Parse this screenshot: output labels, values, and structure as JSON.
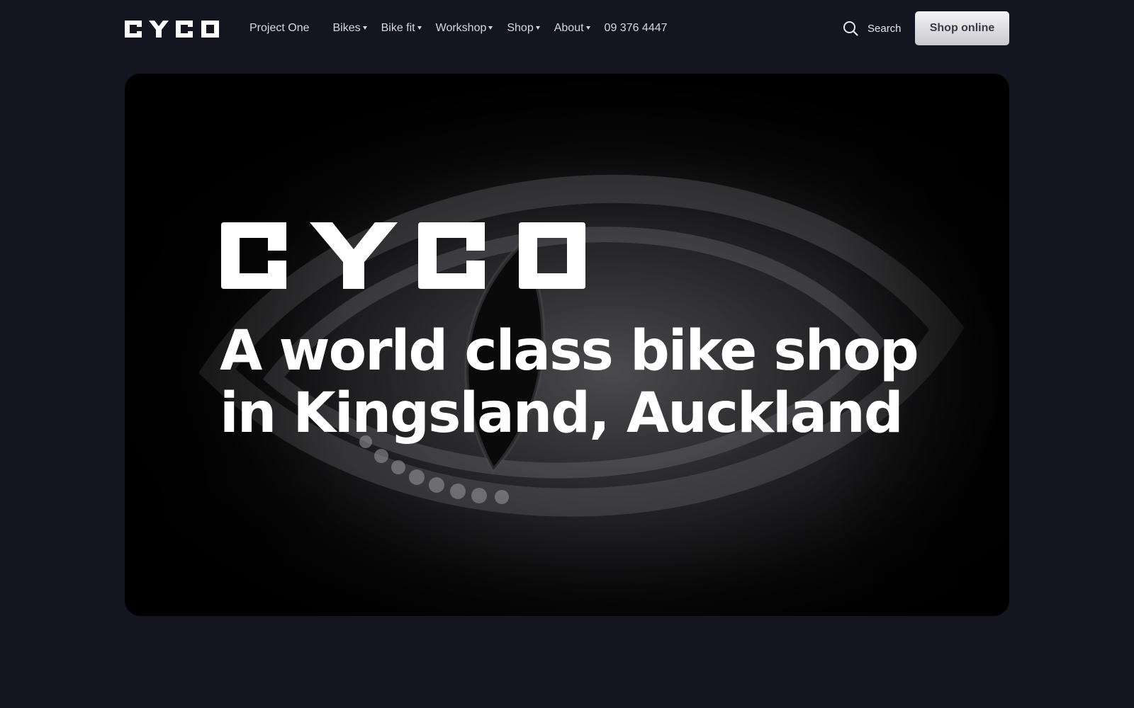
{
  "header": {
    "logo_alt": "CYCO",
    "nav": [
      {
        "label": "Project One",
        "dropdown": false
      },
      {
        "label": "Bikes",
        "dropdown": true
      },
      {
        "label": "Bike fit",
        "dropdown": true
      },
      {
        "label": "Workshop",
        "dropdown": true
      },
      {
        "label": "Shop",
        "dropdown": true
      },
      {
        "label": "About",
        "dropdown": true
      },
      {
        "label": "09 376 4447",
        "dropdown": false
      }
    ],
    "search_label": "Search",
    "search_icon": "search-icon",
    "cta_label": "Shop online"
  },
  "hero": {
    "logo_text": "CYCO",
    "headline_line1": "A world class bike shop",
    "headline_line2": "in Kingsland, Auckland"
  },
  "colors": {
    "background": "#151522",
    "nav_text": "#d7d7de",
    "button_top": "#f4f4f6",
    "button_bottom": "#c9c9cf",
    "button_text": "#3a3a44",
    "headline": "#ffffff"
  }
}
